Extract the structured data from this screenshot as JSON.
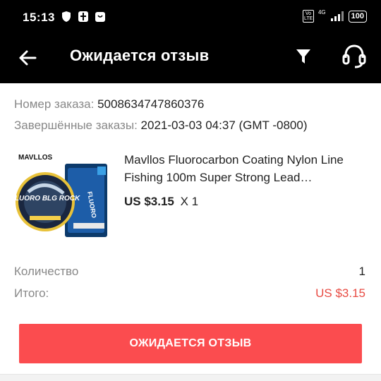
{
  "status_bar": {
    "time": "15:13",
    "left_icons": [
      "shield-icon",
      "vpn-icon",
      "shopping-bag-icon"
    ],
    "volte": "Vo LTE",
    "network": "4G",
    "battery": "100"
  },
  "app_bar": {
    "title": "Ожидается отзыв",
    "icons": [
      "back-arrow-icon",
      "filter-icon",
      "headset-icon"
    ]
  },
  "order": {
    "number_label": "Номер заказа:",
    "number_value": "5008634747860376",
    "completed_label": "Завершённые заказы:",
    "completed_value": "2021-03-03 04:37 (GMT -0800)"
  },
  "product": {
    "image_brand": "MAVLLOS",
    "image_spool_text": "FLUORO BLG ROCK",
    "title": "Mavllos Fluorocarbon Coating Nylon Line Fishing 100m Super Strong Lead…",
    "price": "US $3.15",
    "quantity": "X 1"
  },
  "summary": {
    "quantity_label": "Количество",
    "quantity_value": "1",
    "total_label": "Итого:",
    "total_value": "US $3.15"
  },
  "actions": {
    "review_button": "ОЖИДАЕТСЯ ОТЗЫВ"
  },
  "colors": {
    "accent": "#fb4c4f",
    "price_red": "#e84b43",
    "bar_bg": "#000000"
  }
}
